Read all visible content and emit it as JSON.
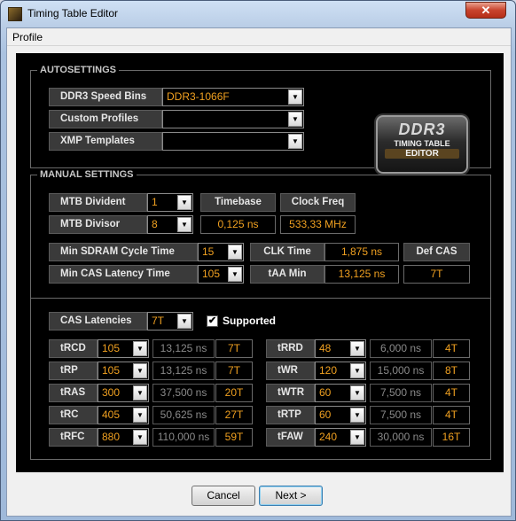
{
  "window": {
    "title": "Timing Table Editor",
    "close_glyph": "✕",
    "icon": "app-icon"
  },
  "menu": {
    "items": [
      "Profile"
    ]
  },
  "auto": {
    "title": "AUTOSETTINGS",
    "speed_bins": {
      "label": "DDR3 Speed Bins",
      "value": "DDR3-1066F"
    },
    "custom_profiles": {
      "label": "Custom Profiles",
      "value": ""
    },
    "xmp_templates": {
      "label": "XMP Templates",
      "value": ""
    },
    "logo": {
      "line1": "DDR3",
      "line2": "TIMING TABLE",
      "line3": "EDITOR"
    }
  },
  "manual": {
    "title": "MANUAL SETTINGS",
    "mtb_divident": {
      "label": "MTB Divident",
      "value": "1"
    },
    "mtb_divisor": {
      "label": "MTB Divisor",
      "value": "8"
    },
    "timebase": {
      "label": "Timebase",
      "value": "0,125 ns"
    },
    "clock_freq": {
      "label": "Clock Freq",
      "value": "533,33 MHz"
    },
    "min_sdram_cycle": {
      "label": "Min SDRAM Cycle Time",
      "value": "15"
    },
    "min_cas_latency": {
      "label": "Min CAS Latency Time",
      "value": "105"
    },
    "clk_time": {
      "label": "CLK Time",
      "value": "1,875 ns"
    },
    "taa_min": {
      "label": "tAA Min",
      "value": "13,125 ns"
    },
    "def_cas": {
      "label": "Def CAS",
      "value": "7T"
    },
    "cas_latencies": {
      "label": "CAS Latencies",
      "value": "7T",
      "supported_label": "Supported",
      "supported_check": "✔"
    }
  },
  "timings_left": [
    {
      "label": "tRCD",
      "value": "105",
      "ns": "13,125 ns",
      "t": "7T"
    },
    {
      "label": "tRP",
      "value": "105",
      "ns": "13,125 ns",
      "t": "7T"
    },
    {
      "label": "tRAS",
      "value": "300",
      "ns": "37,500 ns",
      "t": "20T"
    },
    {
      "label": "tRC",
      "value": "405",
      "ns": "50,625 ns",
      "t": "27T"
    },
    {
      "label": "tRFC",
      "value": "880",
      "ns": "110,000 ns",
      "t": "59T"
    }
  ],
  "timings_right": [
    {
      "label": "tRRD",
      "value": "48",
      "ns": "6,000 ns",
      "t": "4T"
    },
    {
      "label": "tWR",
      "value": "120",
      "ns": "15,000 ns",
      "t": "8T"
    },
    {
      "label": "tWTR",
      "value": "60",
      "ns": "7,500 ns",
      "t": "4T"
    },
    {
      "label": "tRTP",
      "value": "60",
      "ns": "7,500 ns",
      "t": "4T"
    },
    {
      "label": "tFAW",
      "value": "240",
      "ns": "30,000 ns",
      "t": "16T"
    }
  ],
  "buttons": {
    "cancel": "Cancel",
    "next": "Next >"
  },
  "colors": {
    "accent_value": "#f0a020",
    "panel_bg": "#000000"
  }
}
